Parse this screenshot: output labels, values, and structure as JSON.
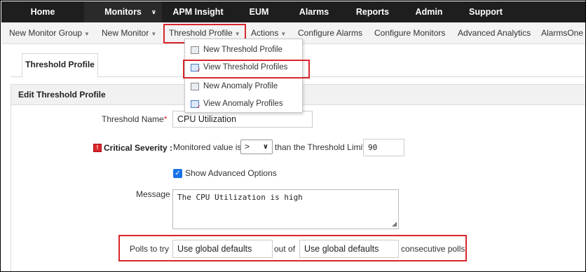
{
  "top_nav": {
    "items": [
      {
        "label": "Home"
      },
      {
        "label": "Monitors"
      },
      {
        "label": "APM Insight"
      },
      {
        "label": "EUM"
      },
      {
        "label": "Alarms"
      },
      {
        "label": "Reports"
      },
      {
        "label": "Admin"
      },
      {
        "label": "Support"
      }
    ],
    "active": "Monitors"
  },
  "sub_nav": {
    "items": [
      {
        "label": "New Monitor Group"
      },
      {
        "label": "New Monitor"
      },
      {
        "label": "Threshold Profile"
      },
      {
        "label": "Actions"
      },
      {
        "label": "Configure Alarms"
      },
      {
        "label": "Configure Monitors"
      },
      {
        "label": "Advanced Analytics"
      },
      {
        "label": "AlarmsOne"
      }
    ]
  },
  "dropdown": {
    "items": [
      {
        "label": "New Threshold Profile",
        "icon": "new-profile-icon"
      },
      {
        "label": "View Threshold Profiles",
        "icon": "view-profiles-icon"
      },
      {
        "label": "New Anomaly Profile",
        "icon": "new-profile-icon"
      },
      {
        "label": "View Anomaly Profiles",
        "icon": "view-profiles-icon"
      }
    ]
  },
  "tab": {
    "label": "Threshold Profile"
  },
  "panel": {
    "title": "Edit Threshold Profile"
  },
  "form": {
    "threshold_name_label": "Threshold Name",
    "required_mark": "*",
    "threshold_name_value": "CPU Utilization",
    "critical_label": "Critical Severity :",
    "monitored_value_label": "Monitored value is",
    "operator_value": ">",
    "than_label": "than the Threshold Limit",
    "limit_value": "90",
    "advanced_label": "Show Advanced Options",
    "advanced_checked": true,
    "message_label": "Message",
    "message_value": "The CPU Utilization is high",
    "polls_label": "Polls to try",
    "polls_value": "Use global defaults",
    "out_of_label": "out of",
    "consecutive_value": "Use global defaults",
    "consecutive_label": "consecutive polls"
  },
  "colors": {
    "highlight": "#d9262c",
    "topnav_bg": "#1e1e1e",
    "checkbox": "#1a73e8"
  }
}
